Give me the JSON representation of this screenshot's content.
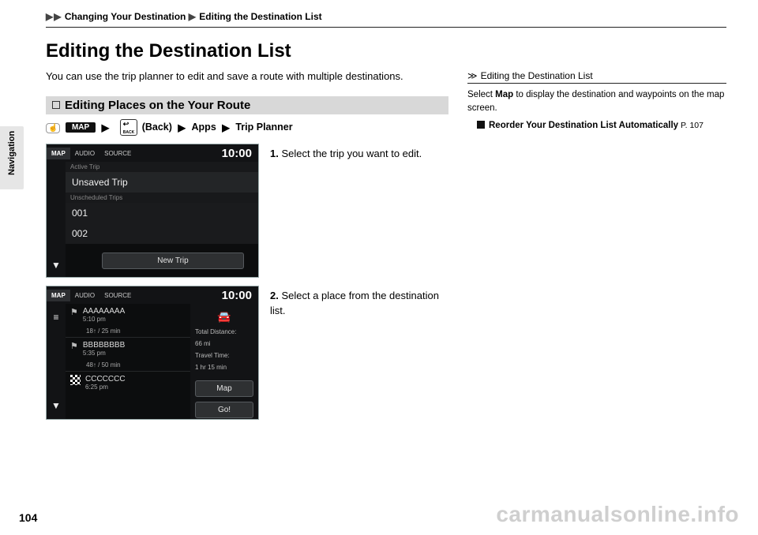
{
  "breadcrumb": {
    "a": "Changing Your Destination",
    "b": "Editing the Destination List"
  },
  "title": "Editing the Destination List",
  "side_tab": "Navigation",
  "intro": "You can use the trip planner to edit and save a route with multiple destinations.",
  "section_heading": "Editing Places on the Your Route",
  "nav_path": {
    "map_btn": "MAP",
    "back_text": "(Back)",
    "apps": "Apps",
    "tp": "Trip Planner"
  },
  "step1": "Select the trip you want to edit.",
  "step2": "Select a place from the destination list.",
  "screen1": {
    "tab_map": "MAP",
    "tab_audio": "AUDIO",
    "tab_source": "SOURCE",
    "time": "10:00",
    "active_label": "Active Trip",
    "active_item": "Unsaved Trip",
    "sched_label": "Unscheduled Trips",
    "row1": "001",
    "row2": "002",
    "new_trip": "New Trip"
  },
  "screen2": {
    "tab_map": "MAP",
    "tab_audio": "AUDIO",
    "tab_source": "SOURCE",
    "time": "10:00",
    "items": [
      {
        "name": "AAAAAAAA",
        "sub": "5:10 pm",
        "seg": "18↑ / 25 min"
      },
      {
        "name": "BBBBBBBB",
        "sub": "5:35 pm",
        "seg": "48↑ / 50 min"
      },
      {
        "name": "CCCCCCC",
        "sub": "6:25 pm",
        "seg": ""
      }
    ],
    "right": {
      "dist_l": "Total Distance:",
      "dist_v": "66 mi",
      "time_l": "Travel Time:",
      "time_v": "1 hr 15 min"
    },
    "btn_map": "Map",
    "btn_go": "Go!"
  },
  "note": {
    "head": "Editing the Destination List",
    "l1a": "Select ",
    "l1b": "Map",
    "l1c": " to display the destination and waypoints on the map screen.",
    "l2": "Reorder Your Destination List Automatically",
    "pref": " P. 107"
  },
  "page_num": "104",
  "watermark": "carmanualsonline.info"
}
